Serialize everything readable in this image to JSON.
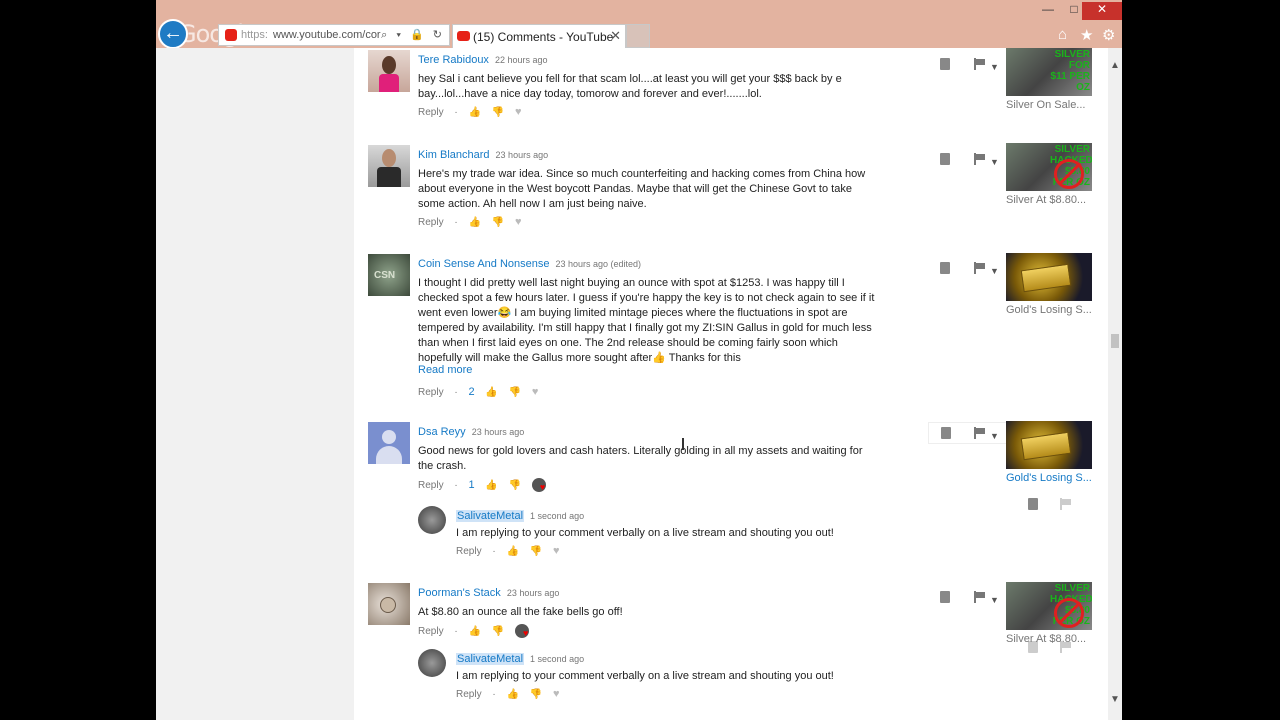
{
  "browser": {
    "back_glyph": "←",
    "logo_text": "Google",
    "url": "www.youtube.com/cor",
    "url_prefix": "https:",
    "addr_icons": "⌕ ▾ 🔒 ↻",
    "tab_title": "(15) Comments - YouTube",
    "tab_close": "✕",
    "minimize": "—",
    "maximize": "□",
    "close": "✕",
    "home_icon": "⌂",
    "favorites_icon": "★",
    "settings_icon": "⚙"
  },
  "scroll": {
    "up": "▲",
    "down": "▼"
  },
  "labels": {
    "reply": "Reply",
    "dot": "·",
    "caret": "▼",
    "read_more": "Read more",
    "thumbs_up": "👍",
    "thumbs_down": "👎",
    "heart": "♥"
  },
  "comments": [
    {
      "author": "Tere Rabidoux",
      "time": "22 hours ago",
      "text": "hey Sal i cant believe you fell for that scam lol....at least you will get your $$$ back by e bay...lol...have a nice day today, tomorow and forever and ever!.......lol.",
      "likes": "",
      "thumbnail": {
        "title": "Silver On Sale...",
        "type": "silver",
        "overlay": "SILVER FOR $11 PER OZ"
      }
    },
    {
      "author": "Kim Blanchard",
      "time": "23 hours ago",
      "text": "Here's my trade war idea. Since so much counterfeiting and hacking comes from China how about everyone in the West boycott Pandas. Maybe that will get the Chinese Govt to take some action. Ah hell now I am just being naive.",
      "likes": "",
      "thumbnail": {
        "title": "Silver At $8.80...",
        "type": "silver-hacked",
        "overlay": "SILVER HACKED $8.80 PER OZ"
      }
    },
    {
      "author": "Coin Sense And Nonsense",
      "time": "23 hours ago (edited)",
      "text": "I thought I did pretty well last night buying an ounce with spot at $1253. I was happy till I checked spot a few hours later. I guess if you're happy the key is to not check again to see if it went even lower😂 I am buying limited mintage pieces where the fluctuations in spot are tempered by availability. I'm still happy that I finally got my ZI:SIN Gallus in gold for much less than when I first laid eyes on one. The 2nd release should be coming fairly soon which hopefully will make the Gallus more sought after👍 Thanks for this",
      "likes": "2",
      "thumbnail": {
        "title": "Gold's Losing S...",
        "type": "gold"
      }
    },
    {
      "author": "Dsa Reyy",
      "time": "23 hours ago",
      "text": "Good news for gold lovers and cash haters. Literally golding in all my assets and waiting for the crash.",
      "likes": "1",
      "thumbnail": {
        "title": "Gold's Losing S...",
        "type": "gold"
      },
      "reply": {
        "author": "SalivateMetal",
        "time": "1 second ago",
        "text": "I am replying to your comment verbally on a live stream and shouting you out!"
      }
    },
    {
      "author": "Poorman's Stack",
      "time": "23 hours ago",
      "text": "At $8.80 an ounce all the fake bells go off!",
      "likes": "",
      "thumbnail": {
        "title": "Silver At $8.80...",
        "type": "silver-hacked",
        "overlay": "SILVER HACKED $8.80 PER OZ"
      },
      "reply": {
        "author": "SalivateMetal",
        "time": "1 second ago",
        "text": "I am replying to your comment verbally on a live stream and shouting you out!"
      }
    }
  ],
  "colors": {
    "link": "#167ac6",
    "titlebar": "#e3b3a0",
    "close": "#c7312b"
  }
}
